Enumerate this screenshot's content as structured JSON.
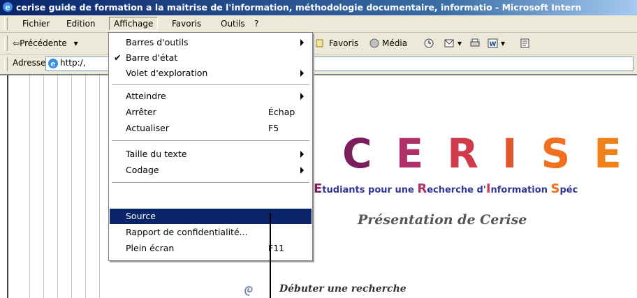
{
  "window": {
    "title": "cerise guide de formation a la maitrise de l'information, méthodologie documentaire, informatio - Microsoft Intern"
  },
  "menubar": {
    "items": [
      "Fichier",
      "Edition",
      "Affichage",
      "Favoris",
      "Outils",
      "?"
    ],
    "active": "Affichage"
  },
  "toolbar": {
    "back_label": "Précédente",
    "favorites_label": "Favoris",
    "media_label": "Média"
  },
  "address": {
    "label": "Adresse",
    "value": "http:/,"
  },
  "dropdown": {
    "items": [
      {
        "label": "Barres d'outils",
        "submenu": true
      },
      {
        "label": "Barre d'état",
        "checked": true
      },
      {
        "label": "Volet d'exploration",
        "submenu": true
      },
      {
        "label": "Atteindre",
        "submenu": true
      },
      {
        "label": "Arrêter",
        "shortcut": "Échap"
      },
      {
        "label": "Actualiser",
        "shortcut": "F5"
      },
      {
        "label": "Taille du texte",
        "submenu": true
      },
      {
        "label": "Codage",
        "submenu": true
      },
      {
        "label": "Source",
        "selected": true
      },
      {
        "label": "Rapport de confidentialité..."
      },
      {
        "label": "Plein écran",
        "shortcut": "F11"
      }
    ]
  },
  "page": {
    "logo_letters": [
      "C",
      "E",
      "R",
      "I",
      "S",
      "E"
    ],
    "logo_colors": [
      "#7a1f5c",
      "#b0306a",
      "#d03a4a",
      "#e0582e",
      "#f07020",
      "#f08018"
    ],
    "tagline_parts": [
      {
        "cap": "E",
        "rest": "tudiants pour une "
      },
      {
        "cap": "R",
        "rest": "echerche d'"
      },
      {
        "cap": "I",
        "rest": "nformation "
      },
      {
        "cap": "S",
        "rest": "péc"
      }
    ],
    "tagline_cap_colors": [
      "#7a1f5c",
      "#b0306a",
      "#d03a4a",
      "#f07020"
    ],
    "presentation": "Présentation de Cerise",
    "start_search": "Débuter une recherche"
  },
  "colors": {
    "titlebar": "#0a246a",
    "selection": "#0a246a",
    "chrome": "#ece9d8"
  }
}
